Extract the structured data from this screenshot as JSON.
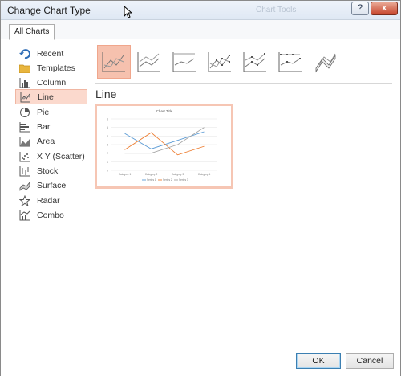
{
  "window": {
    "title": "Change Chart Type",
    "background_title": "Chart Tools",
    "help_label": "?",
    "close_label": "x"
  },
  "tabs": [
    {
      "label": "All Charts"
    }
  ],
  "chart_types": [
    {
      "label": "Recent",
      "icon": "recent-icon"
    },
    {
      "label": "Templates",
      "icon": "folder-icon"
    },
    {
      "label": "Column",
      "icon": "column-chart-icon"
    },
    {
      "label": "Line",
      "icon": "line-chart-icon",
      "selected": true
    },
    {
      "label": "Pie",
      "icon": "pie-chart-icon"
    },
    {
      "label": "Bar",
      "icon": "bar-chart-icon"
    },
    {
      "label": "Area",
      "icon": "area-chart-icon"
    },
    {
      "label": "X Y (Scatter)",
      "icon": "scatter-chart-icon"
    },
    {
      "label": "Stock",
      "icon": "stock-chart-icon"
    },
    {
      "label": "Surface",
      "icon": "surface-chart-icon"
    },
    {
      "label": "Radar",
      "icon": "radar-chart-icon"
    },
    {
      "label": "Combo",
      "icon": "combo-chart-icon"
    }
  ],
  "subtypes": [
    {
      "name": "line",
      "selected": true
    },
    {
      "name": "stacked-line"
    },
    {
      "name": "100-stacked-line"
    },
    {
      "name": "line-with-markers"
    },
    {
      "name": "stacked-line-with-markers"
    },
    {
      "name": "100-stacked-line-with-markers"
    },
    {
      "name": "3d-line"
    }
  ],
  "section_title": "Line",
  "preview": {
    "title": "Chart Title",
    "categories": [
      "Category 1",
      "Category 2",
      "Category 3",
      "Category 4"
    ],
    "yticks": [
      "6",
      "5",
      "4",
      "3",
      "2",
      "1",
      "0"
    ],
    "series": [
      {
        "name": "Series 1",
        "color": "#5b9bd5",
        "values": [
          4.3,
          2.5,
          3.5,
          4.5
        ]
      },
      {
        "name": "Series 2",
        "color": "#ed7d31",
        "values": [
          2.4,
          4.4,
          1.8,
          2.8
        ]
      },
      {
        "name": "Series 3",
        "color": "#a5a5a5",
        "values": [
          2.0,
          2.0,
          3.0,
          5.0
        ]
      }
    ],
    "ylim": [
      0,
      6
    ]
  },
  "buttons": {
    "ok": "OK",
    "cancel": "Cancel"
  },
  "colors": {
    "accent": "#f6c1ae",
    "selected_bg": "#fbd9cd"
  }
}
